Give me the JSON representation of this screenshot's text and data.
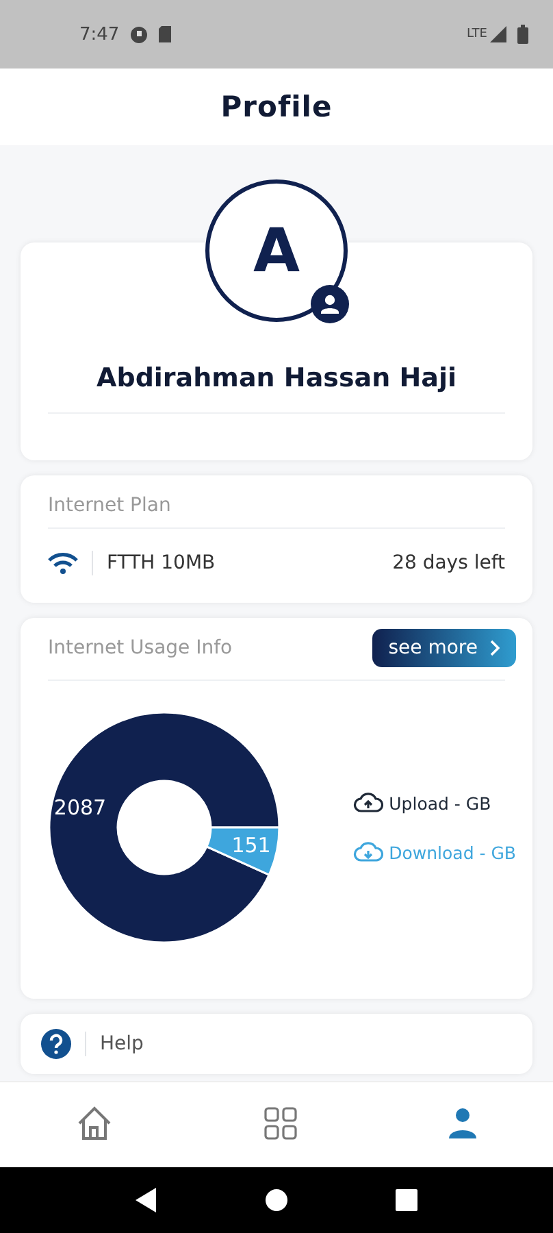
{
  "status_bar": {
    "time": "7:47",
    "network": "LTE"
  },
  "header": {
    "title": "Profile"
  },
  "profile": {
    "initial": "A",
    "name": "Abdirahman Hassan Haji"
  },
  "plan": {
    "title": "Internet Plan",
    "name": "FTTH 10MB",
    "remaining": "28 days left"
  },
  "usage": {
    "title": "Internet Usage Info",
    "button": "see more",
    "chart_data": {
      "type": "donut",
      "categories": [
        "Upload - GB",
        "Download - GB"
      ],
      "values": [
        2087,
        151
      ],
      "colors": [
        "#10214f",
        "#3ea6dd"
      ],
      "data_labels": true
    }
  },
  "menu": [
    {
      "label": "Help"
    }
  ],
  "bottom_nav": [
    {
      "kind": "home",
      "selected": false
    },
    {
      "kind": "grid",
      "selected": false
    },
    {
      "kind": "profile",
      "selected": true
    }
  ]
}
